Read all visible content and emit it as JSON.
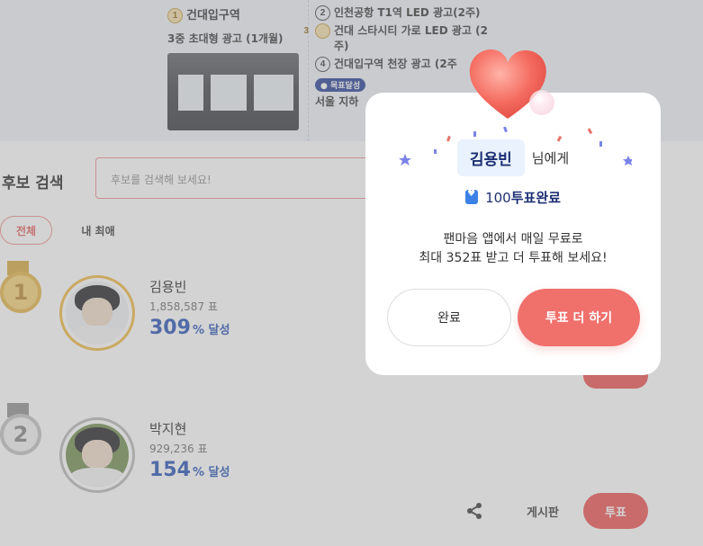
{
  "rewards": {
    "main": {
      "number": "1",
      "title": "건대입구역",
      "subtitle": "3중 초대형 광고 (1개월)"
    },
    "items": [
      {
        "number": "2",
        "text": "인천공항 T1역 LED 광고(2주)"
      },
      {
        "number": "3",
        "text": "건대 스타시티 가로 LED 광고 (2주)"
      },
      {
        "number": "4",
        "text": "건대입구역 천장 광고 (2주"
      }
    ],
    "goal_badge": "● 목표달성",
    "extra": "서울 지하"
  },
  "search": {
    "title": "후보 검색",
    "placeholder": "후보를 검색해 보세요!"
  },
  "filters": [
    {
      "label": "전체",
      "active": true
    },
    {
      "label": "내 최애",
      "active": false
    }
  ],
  "candidates": [
    {
      "rank": "1",
      "name": "김용빈",
      "votes": "1,858,587 표",
      "rate": "309",
      "rate_unit": "% 달성"
    },
    {
      "rank": "2",
      "name": "박지현",
      "votes": "929,236 표",
      "rate": "154",
      "rate_unit": "% 달성"
    }
  ],
  "actions": {
    "board": "게시판",
    "vote": "투표",
    "share_icon": "share-icon"
  },
  "modal": {
    "name": "김용빈",
    "greeting_suffix": "님에게",
    "vote_count": "100",
    "vote_done": "투표완료",
    "message_line1": "팬마음 앱에서 매일 무료로",
    "message_line2": "최대 352표 받고 더 투표해 보세요!",
    "done_button": "완료",
    "more_button": "투표 더 하기"
  },
  "colors": {
    "accent_red": "#f0706c",
    "vote_red": "#ee4d4d",
    "navy": "#1c2f73",
    "rate_blue": "#1f4db3",
    "gold": "#f0b73c",
    "silver": "#b7b7b7"
  }
}
